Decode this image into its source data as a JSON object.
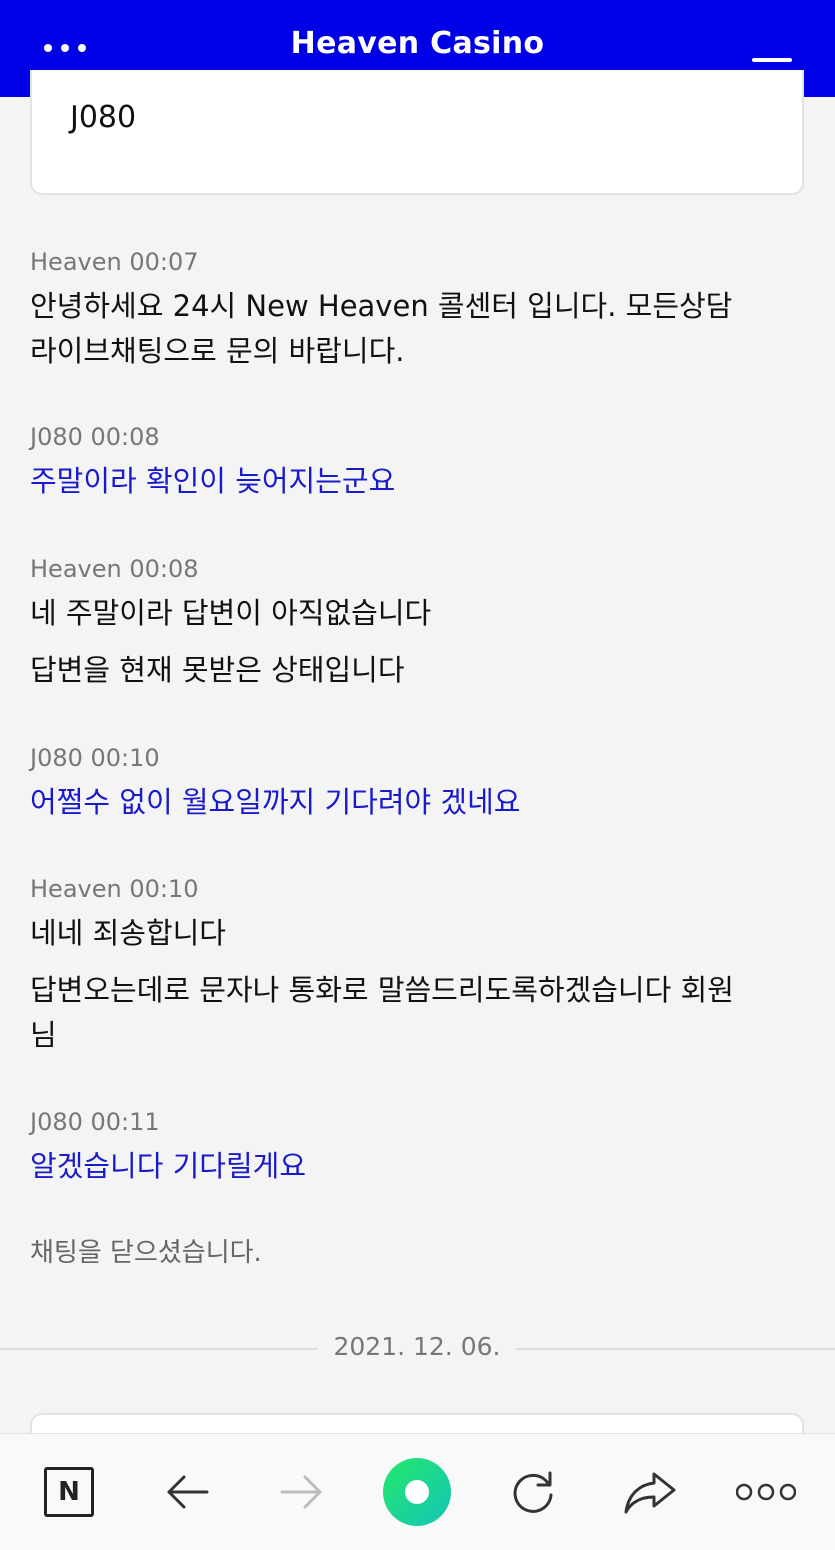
{
  "header": {
    "title": "Heaven Casino",
    "menu_icon": "more-dots-icon",
    "minimize_icon": "minimize-icon"
  },
  "user_card": {
    "name": "J080"
  },
  "messages": [
    {
      "sender": "Heaven",
      "time": "00:07",
      "meta": "Heaven 00:07",
      "role": "agent",
      "lines": [
        "안녕하세요 24시 New Heaven 콜센터 입니다. 모든상담",
        "라이브채팅으로 문의 바랍니다."
      ]
    },
    {
      "sender": "J080",
      "time": "00:08",
      "meta": "J080 00:08",
      "role": "user",
      "lines": [
        "주말이라 확인이 늦어지는군요"
      ]
    },
    {
      "sender": "Heaven",
      "time": "00:08",
      "meta": "Heaven 00:08",
      "role": "agent",
      "lines": [
        "네 주말이라 답변이 아직없습니다",
        "답변을 현재 못받은 상태입니다"
      ]
    },
    {
      "sender": "J080",
      "time": "00:10",
      "meta": "J080 00:10",
      "role": "user",
      "lines": [
        "어쩔수 없이 월요일까지 기다려야 겠네요"
      ]
    },
    {
      "sender": "Heaven",
      "time": "00:10",
      "meta": "Heaven 00:10",
      "role": "agent",
      "lines": [
        "네네 죄송합니다",
        "답변오는데로 문자나 통화로 말씀드리도록하겠습니다 회원",
        "님"
      ]
    },
    {
      "sender": "J080",
      "time": "00:11",
      "meta": "J080 00:11",
      "role": "user",
      "lines": [
        "알겠습니다 기다릴게요"
      ]
    }
  ],
  "chat_closed_notice": "채팅을 닫으셨습니다.",
  "date_divider": "2021. 12. 06.",
  "colors": {
    "header_bg": "#0000e6",
    "user_text": "#1a1acd",
    "agent_text": "#111111"
  },
  "bottom_bar": [
    {
      "name": "naver-home",
      "icon": "n-logo-icon",
      "label": "N"
    },
    {
      "name": "back",
      "icon": "arrow-left-icon"
    },
    {
      "name": "forward",
      "icon": "arrow-right-icon",
      "disabled": true
    },
    {
      "name": "green-dot",
      "icon": "green-circle-icon"
    },
    {
      "name": "reload",
      "icon": "reload-icon"
    },
    {
      "name": "share",
      "icon": "share-icon"
    },
    {
      "name": "more",
      "icon": "more-dots-icon"
    }
  ]
}
